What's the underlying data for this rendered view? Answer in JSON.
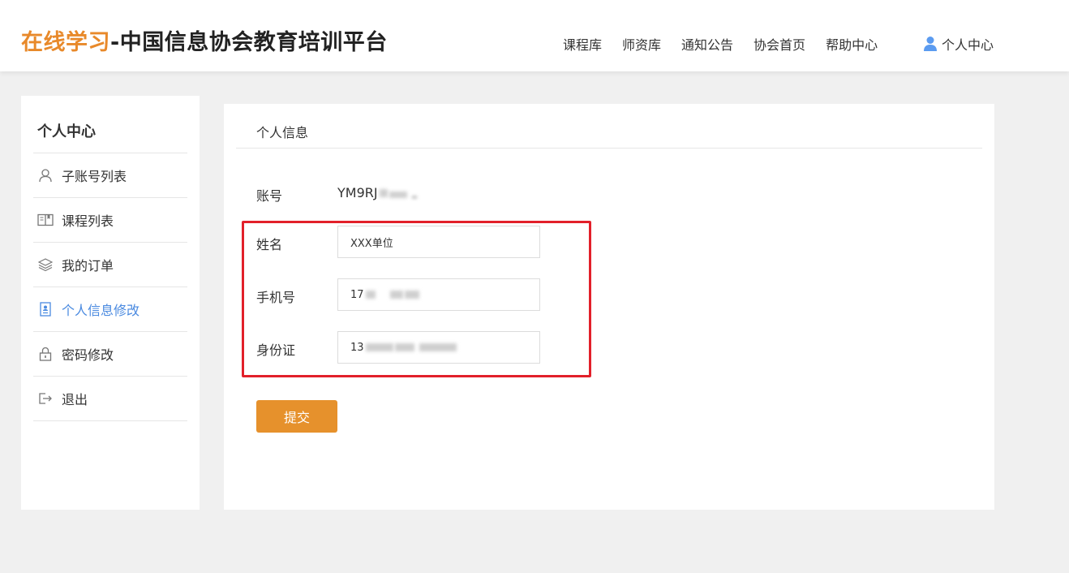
{
  "header": {
    "logo_accent": "在线学习",
    "logo_rest": "-中国信息协会教育培训平台",
    "nav": [
      "课程库",
      "师资库",
      "通知公告",
      "协会首页",
      "帮助中心"
    ],
    "user_center": "个人中心"
  },
  "sidebar": {
    "title": "个人中心",
    "items": [
      {
        "label": "子账号列表",
        "icon": "user-icon"
      },
      {
        "label": "课程列表",
        "icon": "book-icon"
      },
      {
        "label": "我的订单",
        "icon": "layers-icon"
      },
      {
        "label": "个人信息修改",
        "icon": "profile-doc-icon",
        "active": true
      },
      {
        "label": "密码修改",
        "icon": "lock-icon"
      },
      {
        "label": "退出",
        "icon": "logout-icon"
      }
    ]
  },
  "main": {
    "title": "个人信息",
    "account_label": "账号",
    "account_value": "YM9RJ",
    "name_label": "姓名",
    "name_value": "XXX单位",
    "phone_label": "手机号",
    "phone_value": "17",
    "id_label": "身份证",
    "id_value": "13",
    "submit_label": "提交"
  },
  "colors": {
    "accent": "#e8892a",
    "button": "#e6912c",
    "active_link": "#4a8ae0",
    "highlight_border": "#e2202a"
  }
}
